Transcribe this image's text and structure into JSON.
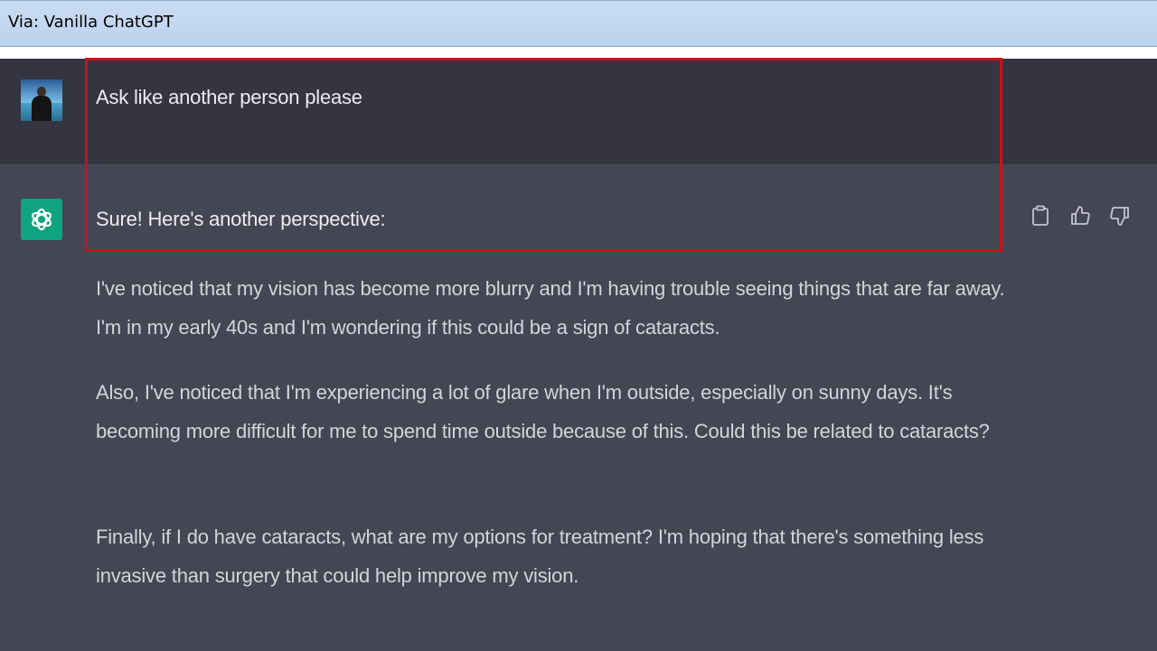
{
  "caption": "Via: Vanilla ChatGPT",
  "user_message": {
    "avatar": "user-photo-avatar",
    "text": "Ask like another person please"
  },
  "assistant_message": {
    "avatar": "openai-logo-icon",
    "intro": "Sure! Here's another perspective:",
    "paragraphs": [
      "I've noticed that my vision has become more blurry and I'm having trouble seeing things that are far away. I'm in my early 40s and I'm wondering if this could be a sign of cataracts.",
      "Also, I've noticed that I'm experiencing a lot of glare when I'm outside, especially on sunny days. It's becoming more difficult for me to spend time outside because of this. Could this be related to cataracts?",
      "Finally, if I do have cataracts, what are my options for treatment? I'm hoping that there's something less invasive than surgery that could help improve my vision."
    ],
    "actions": [
      "copy-icon",
      "thumbs-up-icon",
      "thumbs-down-icon"
    ]
  },
  "colors": {
    "user_bg": "#343541",
    "assistant_bg": "#444654",
    "openai_green": "#10a37f",
    "highlight_red": "#d10f1a"
  }
}
